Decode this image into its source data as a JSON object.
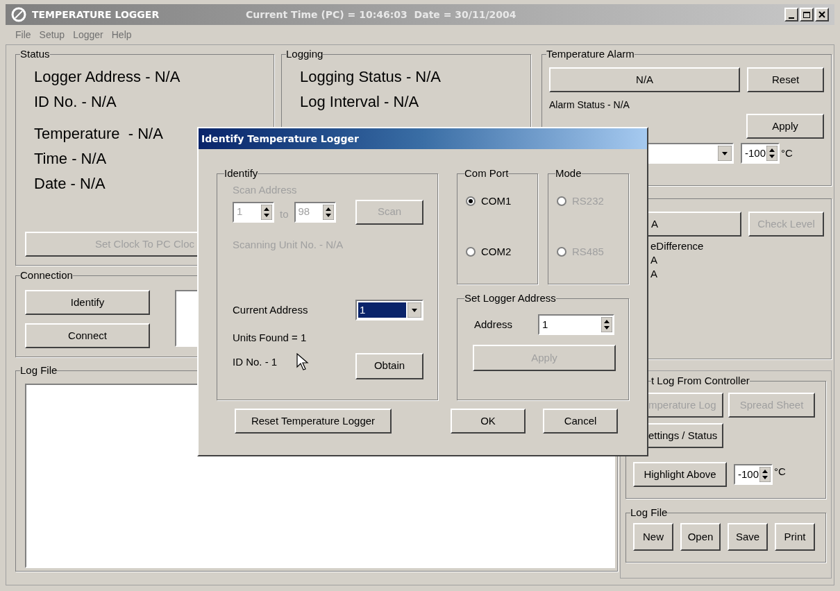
{
  "window": {
    "title": "TEMPERATURE LOGGER",
    "clock": "Current Time (PC) = 10:46:03  Date = 30/11/2004"
  },
  "menu": [
    "File",
    "Setup",
    "Logger",
    "Help"
  ],
  "status": {
    "title": "Status",
    "lines": [
      "Logger Address - N/A",
      "ID No. - N/A",
      "Temperature  - N/A",
      "Time - N/A",
      "Date - N/A"
    ],
    "button": {
      "label": "Set Clock To PC Cloc",
      "disabled": true
    }
  },
  "connection": {
    "title": "Connection",
    "buttons": [
      {
        "label": "Identify",
        "disabled": false
      },
      {
        "label": "Connect",
        "disabled": false
      }
    ]
  },
  "logging": {
    "title": "Logging",
    "lines": [
      "Logging Status - N/A",
      "Log Interval - N/A"
    ]
  },
  "temperature_alarm": {
    "title": "Temperature Alarm",
    "indicator": "N/A",
    "reset": {
      "label": "Reset",
      "disabled": false
    },
    "alarm_status": "Alarm Status - N/A",
    "apply": {
      "label": "Apply",
      "disabled": false
    },
    "threshold": "-100",
    "unit": "°C"
  },
  "level_panel": {
    "field": "A",
    "check_level": {
      "label": "Check Level",
      "disabled": true
    },
    "lines": [
      "eDifference",
      "A",
      "A"
    ]
  },
  "log_file": {
    "title": "Log File"
  },
  "controller": {
    "title": "t Log From Controller",
    "buttons": [
      {
        "label": "mperature Log",
        "disabled": true
      },
      {
        "label": "Spread Sheet",
        "disabled": true
      },
      {
        "label": "ettings / Status",
        "disabled": false
      }
    ],
    "highlight": {
      "label": "Highlight Above",
      "disabled": false
    },
    "threshold": "-100",
    "unit": "°C"
  },
  "log_file_panel": {
    "title": "Log File",
    "buttons": [
      {
        "label": "New",
        "disabled": false
      },
      {
        "label": "Open",
        "disabled": false
      },
      {
        "label": "Save",
        "disabled": false
      },
      {
        "label": "Print",
        "disabled": false
      }
    ]
  },
  "dialog": {
    "title": "Identify Temperature Logger",
    "identify": {
      "title": "Identify",
      "scan_disabled": true,
      "scan_label": "Scan Address",
      "scan_from": "1",
      "scan_to_label": "to",
      "scan_to": "98",
      "scan_button": "Scan",
      "scanning": "Scanning Unit No. - N/A",
      "current_address_label": "Current Address",
      "current_address": "1",
      "units_found": "Units Found = 1",
      "id_no": "ID No. - 1",
      "obtain": {
        "label": "Obtain",
        "disabled": false
      }
    },
    "com_port": {
      "title": "Com Port",
      "disabled": false,
      "options": [
        {
          "label": "COM1",
          "selected": true
        },
        {
          "label": "COM2",
          "selected": false
        }
      ]
    },
    "mode": {
      "title": "Mode",
      "disabled": true,
      "options": [
        {
          "label": "RS232",
          "selected": false
        },
        {
          "label": "RS485",
          "selected": false
        }
      ]
    },
    "set_address": {
      "title": "Set Logger Address",
      "label": "Address",
      "value": "1",
      "apply": {
        "label": "Apply",
        "disabled": true
      }
    },
    "buttons": [
      {
        "label": "Reset Temperature Logger",
        "disabled": false
      },
      {
        "label": "OK",
        "disabled": false
      },
      {
        "label": "Cancel",
        "disabled": false
      }
    ]
  }
}
